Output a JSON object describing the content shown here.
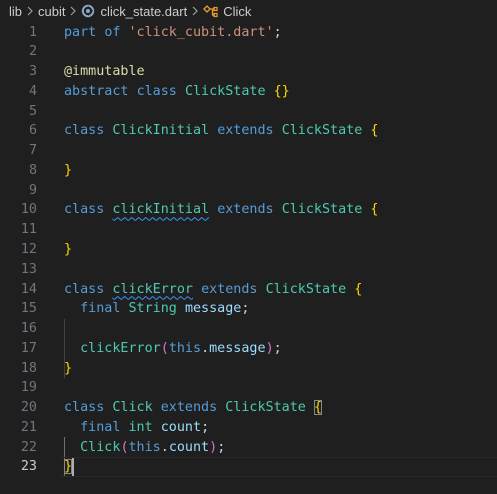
{
  "breadcrumb": {
    "folder1": "lib",
    "folder2": "cubit",
    "file": "click_state.dart",
    "symbol": "Click",
    "file_icon": "dart-file-icon",
    "symbol_icon": "class-symbol-icon",
    "sep_icon": "chevron-right-icon"
  },
  "editor": {
    "active_line": 23,
    "lines": [
      {
        "n": "1"
      },
      {
        "n": "2"
      },
      {
        "n": "3"
      },
      {
        "n": "4"
      },
      {
        "n": "5"
      },
      {
        "n": "6"
      },
      {
        "n": "7"
      },
      {
        "n": "8"
      },
      {
        "n": "9"
      },
      {
        "n": "10"
      },
      {
        "n": "11"
      },
      {
        "n": "12"
      },
      {
        "n": "13"
      },
      {
        "n": "14"
      },
      {
        "n": "15"
      },
      {
        "n": "16"
      },
      {
        "n": "17"
      },
      {
        "n": "18"
      },
      {
        "n": "19"
      },
      {
        "n": "20"
      },
      {
        "n": "21"
      },
      {
        "n": "22"
      },
      {
        "n": "23"
      }
    ],
    "tokens": {
      "kw_part": "part",
      "kw_of": "of",
      "str_part": "'click_cubit.dart'",
      "semi": ";",
      "ann_immutable": "@immutable",
      "kw_abstract": "abstract",
      "kw_class": "class",
      "kw_extends": "extends",
      "kw_final": "final",
      "kw_this": "this",
      "type_ClickState": "ClickState",
      "type_ClickInitial": "ClickInitial",
      "type_clickInitial": "clickInitial",
      "type_clickError": "clickError",
      "type_String": "String",
      "type_int": "int",
      "type_Click": "Click",
      "var_message": "message",
      "var_count": "count",
      "fn_clickError": "clickError",
      "fn_Click": "Click",
      "lbrace": "{",
      "rbrace": "}",
      "empty_braces": "{}",
      "lparen": "(",
      "rparen": ")",
      "dot": "."
    }
  }
}
